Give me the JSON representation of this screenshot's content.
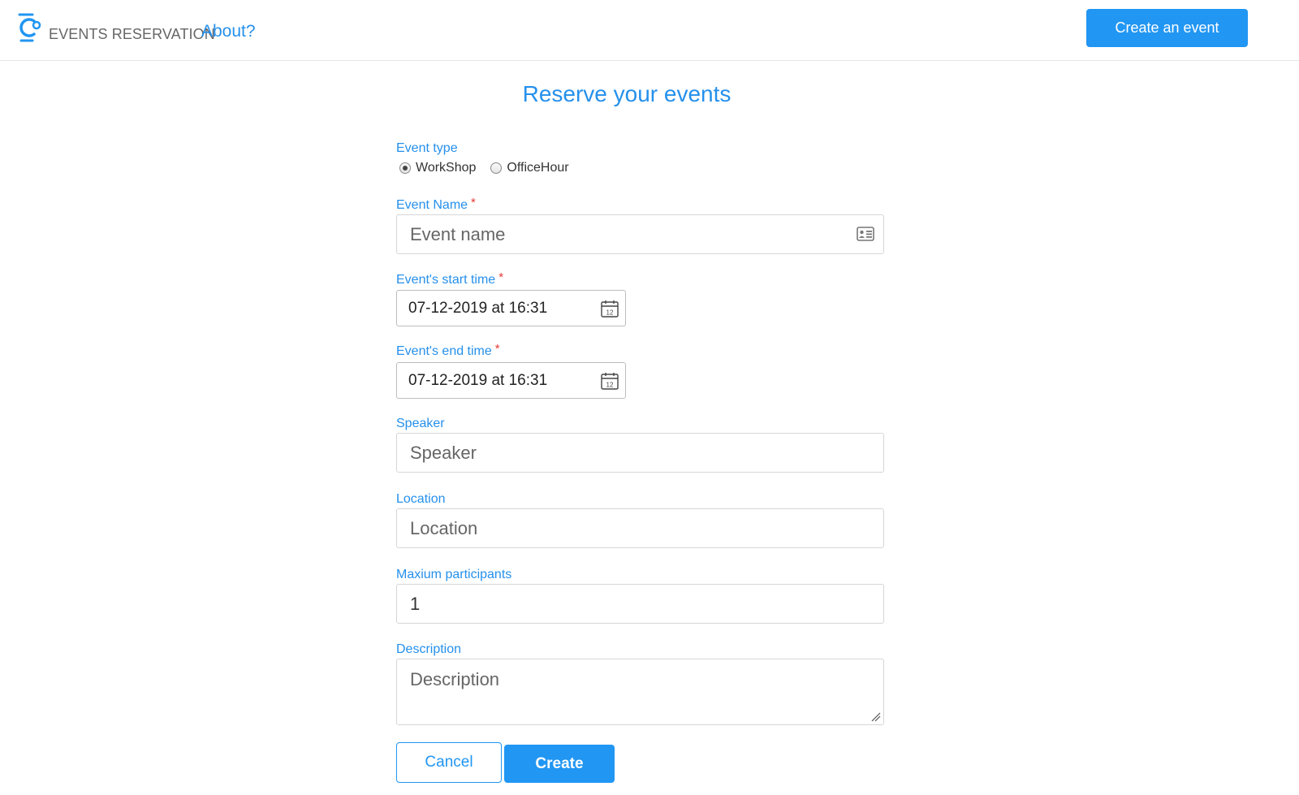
{
  "header": {
    "brand_name": "EVENTS RESERVATION",
    "about_link": "About?",
    "create_event_button": "Create an event",
    "accent_color": "#2196f3"
  },
  "page": {
    "title": "Reserve your events"
  },
  "form": {
    "event_type": {
      "label": "Event type",
      "options": [
        "WorkShop",
        "OfficeHour"
      ],
      "selected": "WorkShop"
    },
    "event_name": {
      "label": "Event Name",
      "required_mark": "*",
      "placeholder": "Event name",
      "value": "",
      "icon": "id-card-icon"
    },
    "start_time": {
      "label": "Event's start time",
      "required_mark": "*",
      "value": "07-12-2019 at 16:31",
      "icon": "calendar-icon"
    },
    "end_time": {
      "label": "Event's end time",
      "required_mark": "*",
      "value": "07-12-2019 at 16:31",
      "icon": "calendar-icon"
    },
    "speaker": {
      "label": "Speaker",
      "placeholder": "Speaker",
      "value": ""
    },
    "location": {
      "label": "Location",
      "placeholder": "Location",
      "value": ""
    },
    "max_participants": {
      "label": "Maxium participants",
      "value": "1"
    },
    "description": {
      "label": "Description",
      "placeholder": "Description",
      "value": ""
    },
    "cancel_button": "Cancel",
    "create_button": "Create"
  }
}
